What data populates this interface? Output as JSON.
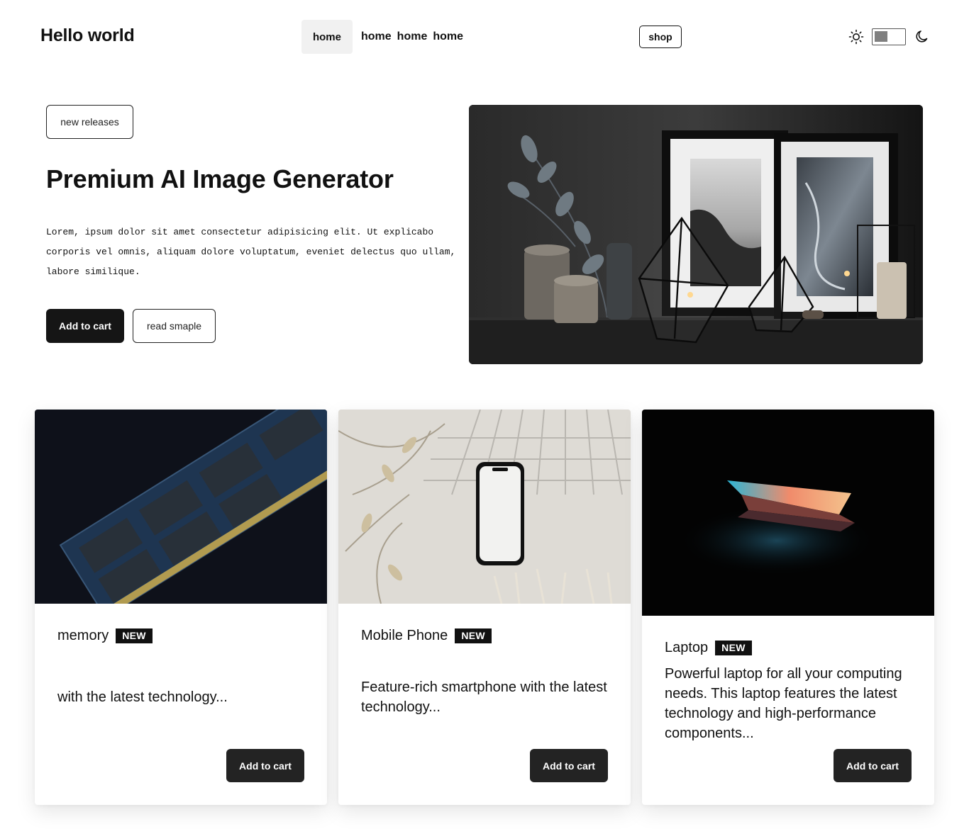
{
  "header": {
    "brand": "Hello world",
    "nav": [
      {
        "label": "home",
        "active": true
      },
      {
        "label": "home",
        "active": false
      },
      {
        "label": "home",
        "active": false
      },
      {
        "label": "home",
        "active": false
      }
    ],
    "shop_label": "shop",
    "theme_toggle": {
      "sun_icon": "sun-icon",
      "moon_icon": "moon-icon"
    }
  },
  "hero": {
    "tag": "new releases",
    "title": "Premium AI Image Generator",
    "description": "Lorem, ipsum dolor sit amet consectetur adipisicing elit. Ut explicabo corporis vel omnis, aliquam dolore voluptatum, eveniet delectus quo ullam, labore similique.",
    "primary_button": "Add to cart",
    "secondary_button": "read smaple"
  },
  "cards": [
    {
      "title": "memory",
      "badge": "NEW",
      "description": "with the latest technology...",
      "button": "Add to cart"
    },
    {
      "title": "Mobile Phone",
      "badge": "NEW",
      "description": "Feature-rich smartphone with the latest technology...",
      "button": "Add to cart"
    },
    {
      "title": "Laptop",
      "badge": "NEW",
      "description": "Powerful laptop for all your computing needs. This laptop features the latest technology and high-performance components...",
      "button": "Add to cart"
    }
  ],
  "colors": {
    "dark": "#151515",
    "badge": "#111111",
    "nav_active_bg": "#f1f1f1"
  }
}
